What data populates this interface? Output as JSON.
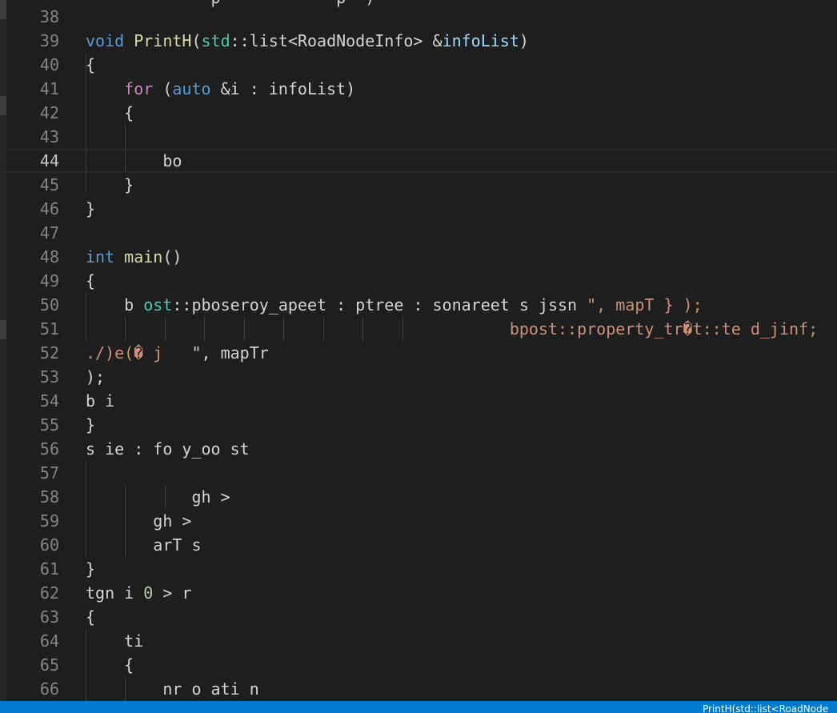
{
  "editor": {
    "partial_top_line": "             p            p  )",
    "current_line": 44,
    "lines": [
      {
        "n": "38",
        "segments": []
      },
      {
        "n": "39",
        "segments": [
          {
            "t": "void",
            "c": "kw"
          },
          {
            "t": " ",
            "c": ""
          },
          {
            "t": "PrintH",
            "c": "fn"
          },
          {
            "t": "(",
            "c": ""
          },
          {
            "t": "std",
            "c": "type"
          },
          {
            "t": "::",
            "c": ""
          },
          {
            "t": "list<RoadNodeInfo> &",
            "c": ""
          },
          {
            "t": "infoList",
            "c": "var"
          },
          {
            "t": ")",
            "c": ""
          }
        ]
      },
      {
        "n": "40",
        "segments": [
          {
            "t": "{",
            "c": ""
          }
        ]
      },
      {
        "n": "41",
        "segments": [
          {
            "t": "    ",
            "c": ""
          },
          {
            "t": "for",
            "c": "ctrl"
          },
          {
            "t": " (",
            "c": ""
          },
          {
            "t": "auto",
            "c": "kw"
          },
          {
            "t": " &i : infoList)",
            "c": ""
          }
        ]
      },
      {
        "n": "42",
        "segments": [
          {
            "t": "    {",
            "c": ""
          }
        ]
      },
      {
        "n": "43",
        "segments": []
      },
      {
        "n": "44",
        "segments": [
          {
            "t": "        bo",
            "c": ""
          }
        ]
      },
      {
        "n": "45",
        "segments": [
          {
            "t": "    }",
            "c": ""
          }
        ]
      },
      {
        "n": "46",
        "segments": [
          {
            "t": "}",
            "c": ""
          }
        ]
      },
      {
        "n": "47",
        "segments": []
      },
      {
        "n": "48",
        "segments": [
          {
            "t": "int",
            "c": "kw"
          },
          {
            "t": " ",
            "c": ""
          },
          {
            "t": "main",
            "c": "fn"
          },
          {
            "t": "()",
            "c": ""
          }
        ]
      },
      {
        "n": "49",
        "segments": [
          {
            "t": "{",
            "c": ""
          }
        ]
      },
      {
        "n": "50",
        "segments": [
          {
            "t": "    b ",
            "c": ""
          },
          {
            "t": "ost",
            "c": "type"
          },
          {
            "t": "::pboseroy_apeet : ptree : sonareet s jssn ",
            "c": ""
          },
          {
            "t": "\", mapT } );",
            "c": "str"
          }
        ]
      },
      {
        "n": "51",
        "segments": [
          {
            "t": "                                            ",
            "c": ""
          },
          {
            "t": "bpost::property_tr�t::te d_jinf;",
            "c": "str"
          }
        ]
      },
      {
        "n": "52",
        "segments": [
          {
            "t": "./)e(� j   ",
            "c": "str"
          },
          {
            "t": "\", mapTr",
            "c": ""
          }
        ]
      },
      {
        "n": "53",
        "segments": [
          {
            "t": ");",
            "c": ""
          }
        ]
      },
      {
        "n": "54",
        "segments": [
          {
            "t": "b i",
            "c": ""
          }
        ]
      },
      {
        "n": "55",
        "segments": [
          {
            "t": "}",
            "c": ""
          }
        ]
      },
      {
        "n": "56",
        "segments": [
          {
            "t": "s ie : fo y_oo st",
            "c": ""
          }
        ]
      },
      {
        "n": "57",
        "segments": []
      },
      {
        "n": "58",
        "segments": [
          {
            "t": "           gh >",
            "c": ""
          }
        ]
      },
      {
        "n": "59",
        "segments": [
          {
            "t": "       gh >",
            "c": ""
          }
        ]
      },
      {
        "n": "60",
        "segments": [
          {
            "t": "       arT s",
            "c": ""
          }
        ]
      },
      {
        "n": "61",
        "segments": [
          {
            "t": "}",
            "c": ""
          }
        ]
      },
      {
        "n": "62",
        "segments": [
          {
            "t": "tgn i ",
            "c": ""
          },
          {
            "t": "0",
            "c": "num"
          },
          {
            "t": " > r",
            "c": ""
          }
        ]
      },
      {
        "n": "63",
        "segments": [
          {
            "t": "{",
            "c": ""
          }
        ]
      },
      {
        "n": "64",
        "segments": [
          {
            "t": "    ti",
            "c": ""
          }
        ]
      },
      {
        "n": "65",
        "segments": [
          {
            "t": "    {",
            "c": ""
          }
        ]
      },
      {
        "n": "66",
        "segments": [
          {
            "t": "        nr o ati n",
            "c": ""
          }
        ]
      }
    ]
  },
  "status_bar": {
    "breadcrumb": "PrintH(std::list<RoadNode"
  }
}
